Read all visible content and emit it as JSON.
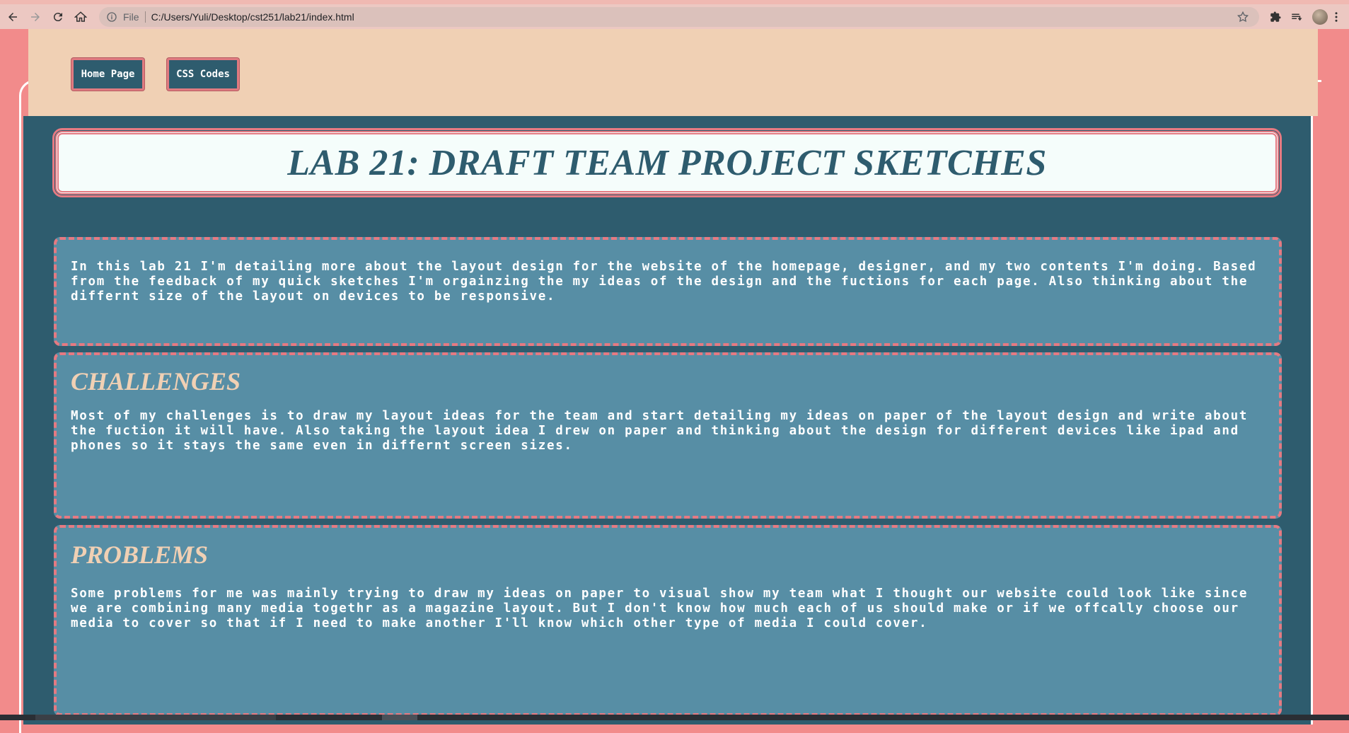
{
  "browser": {
    "scheme_label": "File",
    "url": "C:/Users/Yuli/Desktop/cst251/lab21/index.html"
  },
  "nav": {
    "home": "Home Page",
    "css": "CSS Codes"
  },
  "page": {
    "title": "LAB 21: DRAFT TEAM PROJECT SKETCHES",
    "intro": "In this lab 21 I'm detailing more about the layout design for the website of the homepage, designer, and my two contents I'm doing. Based from the feedback of my quick sketches I'm orgainzing the my ideas of the design and the fuctions for each page. Also thinking about the differnt size of the layout on devices to be responsive.",
    "challenges": {
      "heading": "CHALLENGES",
      "text": "Most of my challenges is to draw my layout ideas for the team and start detailing my ideas on paper of the layout design and write about the fuction it will have. Also taking the layout idea I drew on paper and thinking about the design for different devices like ipad and phones so it stays the same even in differnt screen sizes."
    },
    "problems": {
      "heading": "PROBLEMS",
      "text": "Some problems for me was mainly trying to draw my ideas on paper to visual show my team what I thought our website could look like since we are combining many media togethr as a magazine layout. But I don't know how much each of us should make or if we offcally choose our media to cover so that if I need to make another I'll know which other type of media I could cover."
    }
  },
  "colors": {
    "header_bg": "#f0d0b4",
    "main_bg": "#2e5c6e",
    "card_bg": "#578ea5",
    "accent_pink": "#e57a82",
    "heading_peach": "#f0d0b4"
  }
}
